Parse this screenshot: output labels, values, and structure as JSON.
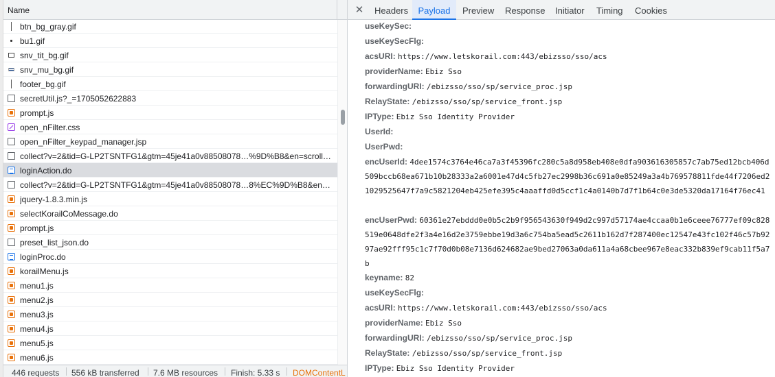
{
  "network_list": {
    "column_header": "Name",
    "requests": [
      {
        "icon": "gif-line-icon",
        "name": "btn_bg_gray.gif"
      },
      {
        "icon": "gif-dot-icon",
        "name": "bu1.gif"
      },
      {
        "icon": "gif-white-icon",
        "name": "snv_tit_bg.gif"
      },
      {
        "icon": "gif-stripe-icon",
        "name": "snv_mu_bg.gif"
      },
      {
        "icon": "gif-line-icon",
        "name": "footer_bg.gif"
      },
      {
        "icon": "document-icon",
        "name": "secretUtil.js?_=1705052622883"
      },
      {
        "icon": "script-icon",
        "name": "prompt.js"
      },
      {
        "icon": "stylesheet-icon",
        "name": "open_nFilter.css"
      },
      {
        "icon": "document-icon",
        "name": "open_nFilter_keypad_manager.jsp"
      },
      {
        "icon": "document-icon",
        "name": "collect?v=2&tid=G-LP2TSNTFG1&gtm=45je41a0v88508078…%9D%B8&en=scroll…"
      },
      {
        "icon": "fetch-icon",
        "name": "loginAction.do",
        "selected": true
      },
      {
        "icon": "document-icon",
        "name": "collect?v=2&tid=G-LP2TSNTFG1&gtm=45je41a0v88508078…8%EC%9D%B8&en…"
      },
      {
        "icon": "script-icon",
        "name": "jquery-1.8.3.min.js"
      },
      {
        "icon": "script-icon",
        "name": "selectKorailCoMessage.do"
      },
      {
        "icon": "script-icon",
        "name": "prompt.js"
      },
      {
        "icon": "document-icon",
        "name": "preset_list_json.do"
      },
      {
        "icon": "fetch-icon",
        "name": "loginProc.do"
      },
      {
        "icon": "script-icon",
        "name": "korailMenu.js"
      },
      {
        "icon": "script-icon",
        "name": "menu1.js"
      },
      {
        "icon": "script-icon",
        "name": "menu2.js"
      },
      {
        "icon": "script-icon",
        "name": "menu3.js"
      },
      {
        "icon": "script-icon",
        "name": "menu4.js"
      },
      {
        "icon": "script-icon",
        "name": "menu5.js"
      },
      {
        "icon": "script-icon",
        "name": "menu6.js"
      }
    ]
  },
  "status_bar": {
    "requests": "446 requests",
    "transferred": "556 kB transferred",
    "resources": "7.6 MB resources",
    "finish": "Finish: 5.33 s",
    "dom_content_loaded": "DOMContentL"
  },
  "tabs": {
    "close_symbol": "✕",
    "items": [
      "Headers",
      "Payload",
      "Preview",
      "Response",
      "Initiator",
      "Timing",
      "Cookies"
    ],
    "active": "Payload"
  },
  "payload": [
    {
      "key": "useKeySec:",
      "value": ""
    },
    {
      "key": "useKeySecFlg:",
      "value": ""
    },
    {
      "key": "acsURI:",
      "value": "https://www.letskorail.com:443/ebizsso/sso/acs"
    },
    {
      "key": "providerName:",
      "value": "Ebiz Sso"
    },
    {
      "key": "forwardingURI:",
      "value": "/ebizsso/sso/sp/service_proc.jsp"
    },
    {
      "key": "RelayState:",
      "value": "/ebizsso/sso/sp/service_front.jsp"
    },
    {
      "key": "IPType:",
      "value": "Ebiz Sso Identity Provider"
    },
    {
      "key": "UserId:",
      "value": ""
    },
    {
      "key": "UserPwd:",
      "value": ""
    },
    {
      "key": "encUserId:",
      "value": "4dee1574c3764e46ca7a3f45396fc280c5a8d958eb408e0dfa903616305857c7ab75ed12bcb406d509bccb68ea671b10b28333a2a6001e47d4c5fb27ec2998b36c691a0e85249a3a4b769578811fde44f7206ed21029525647f7a9c5821204eb425efe395c4aaaffd0d5ccf1c4a0140b7d7f1b64c0e3de5320da17164f76ec41"
    },
    {
      "key": "encUserPwd:",
      "value": "60361e27ebddd0e0b5c2b9f956543630f949d2c997d57174ae4ccaa0b1e6ceee76777ef09c828519e0648dfe2f3a4e16d2e3759ebbe19d3a6c754ba5ead5c2611b162d7f287400ec12547e43fc102f46c57b9297ae92fff95c1c7f70d0b08e7136d624682ae9bed27063a0da611a4a68cbee967e8eac332b839ef9cab11f5a7b"
    },
    {
      "key": "keyname:",
      "value": "82"
    },
    {
      "key": "useKeySecFlg:",
      "value": ""
    },
    {
      "key": "acsURI:",
      "value": "https://www.letskorail.com:443/ebizsso/sso/acs"
    },
    {
      "key": "providerName:",
      "value": "Ebiz Sso"
    },
    {
      "key": "forwardingURI:",
      "value": "/ebizsso/sso/sp/service_proc.jsp"
    },
    {
      "key": "RelayState:",
      "value": "/ebizsso/sso/sp/service_front.jsp"
    },
    {
      "key": "IPType:",
      "value": "Ebiz Sso Identity Provider"
    }
  ]
}
